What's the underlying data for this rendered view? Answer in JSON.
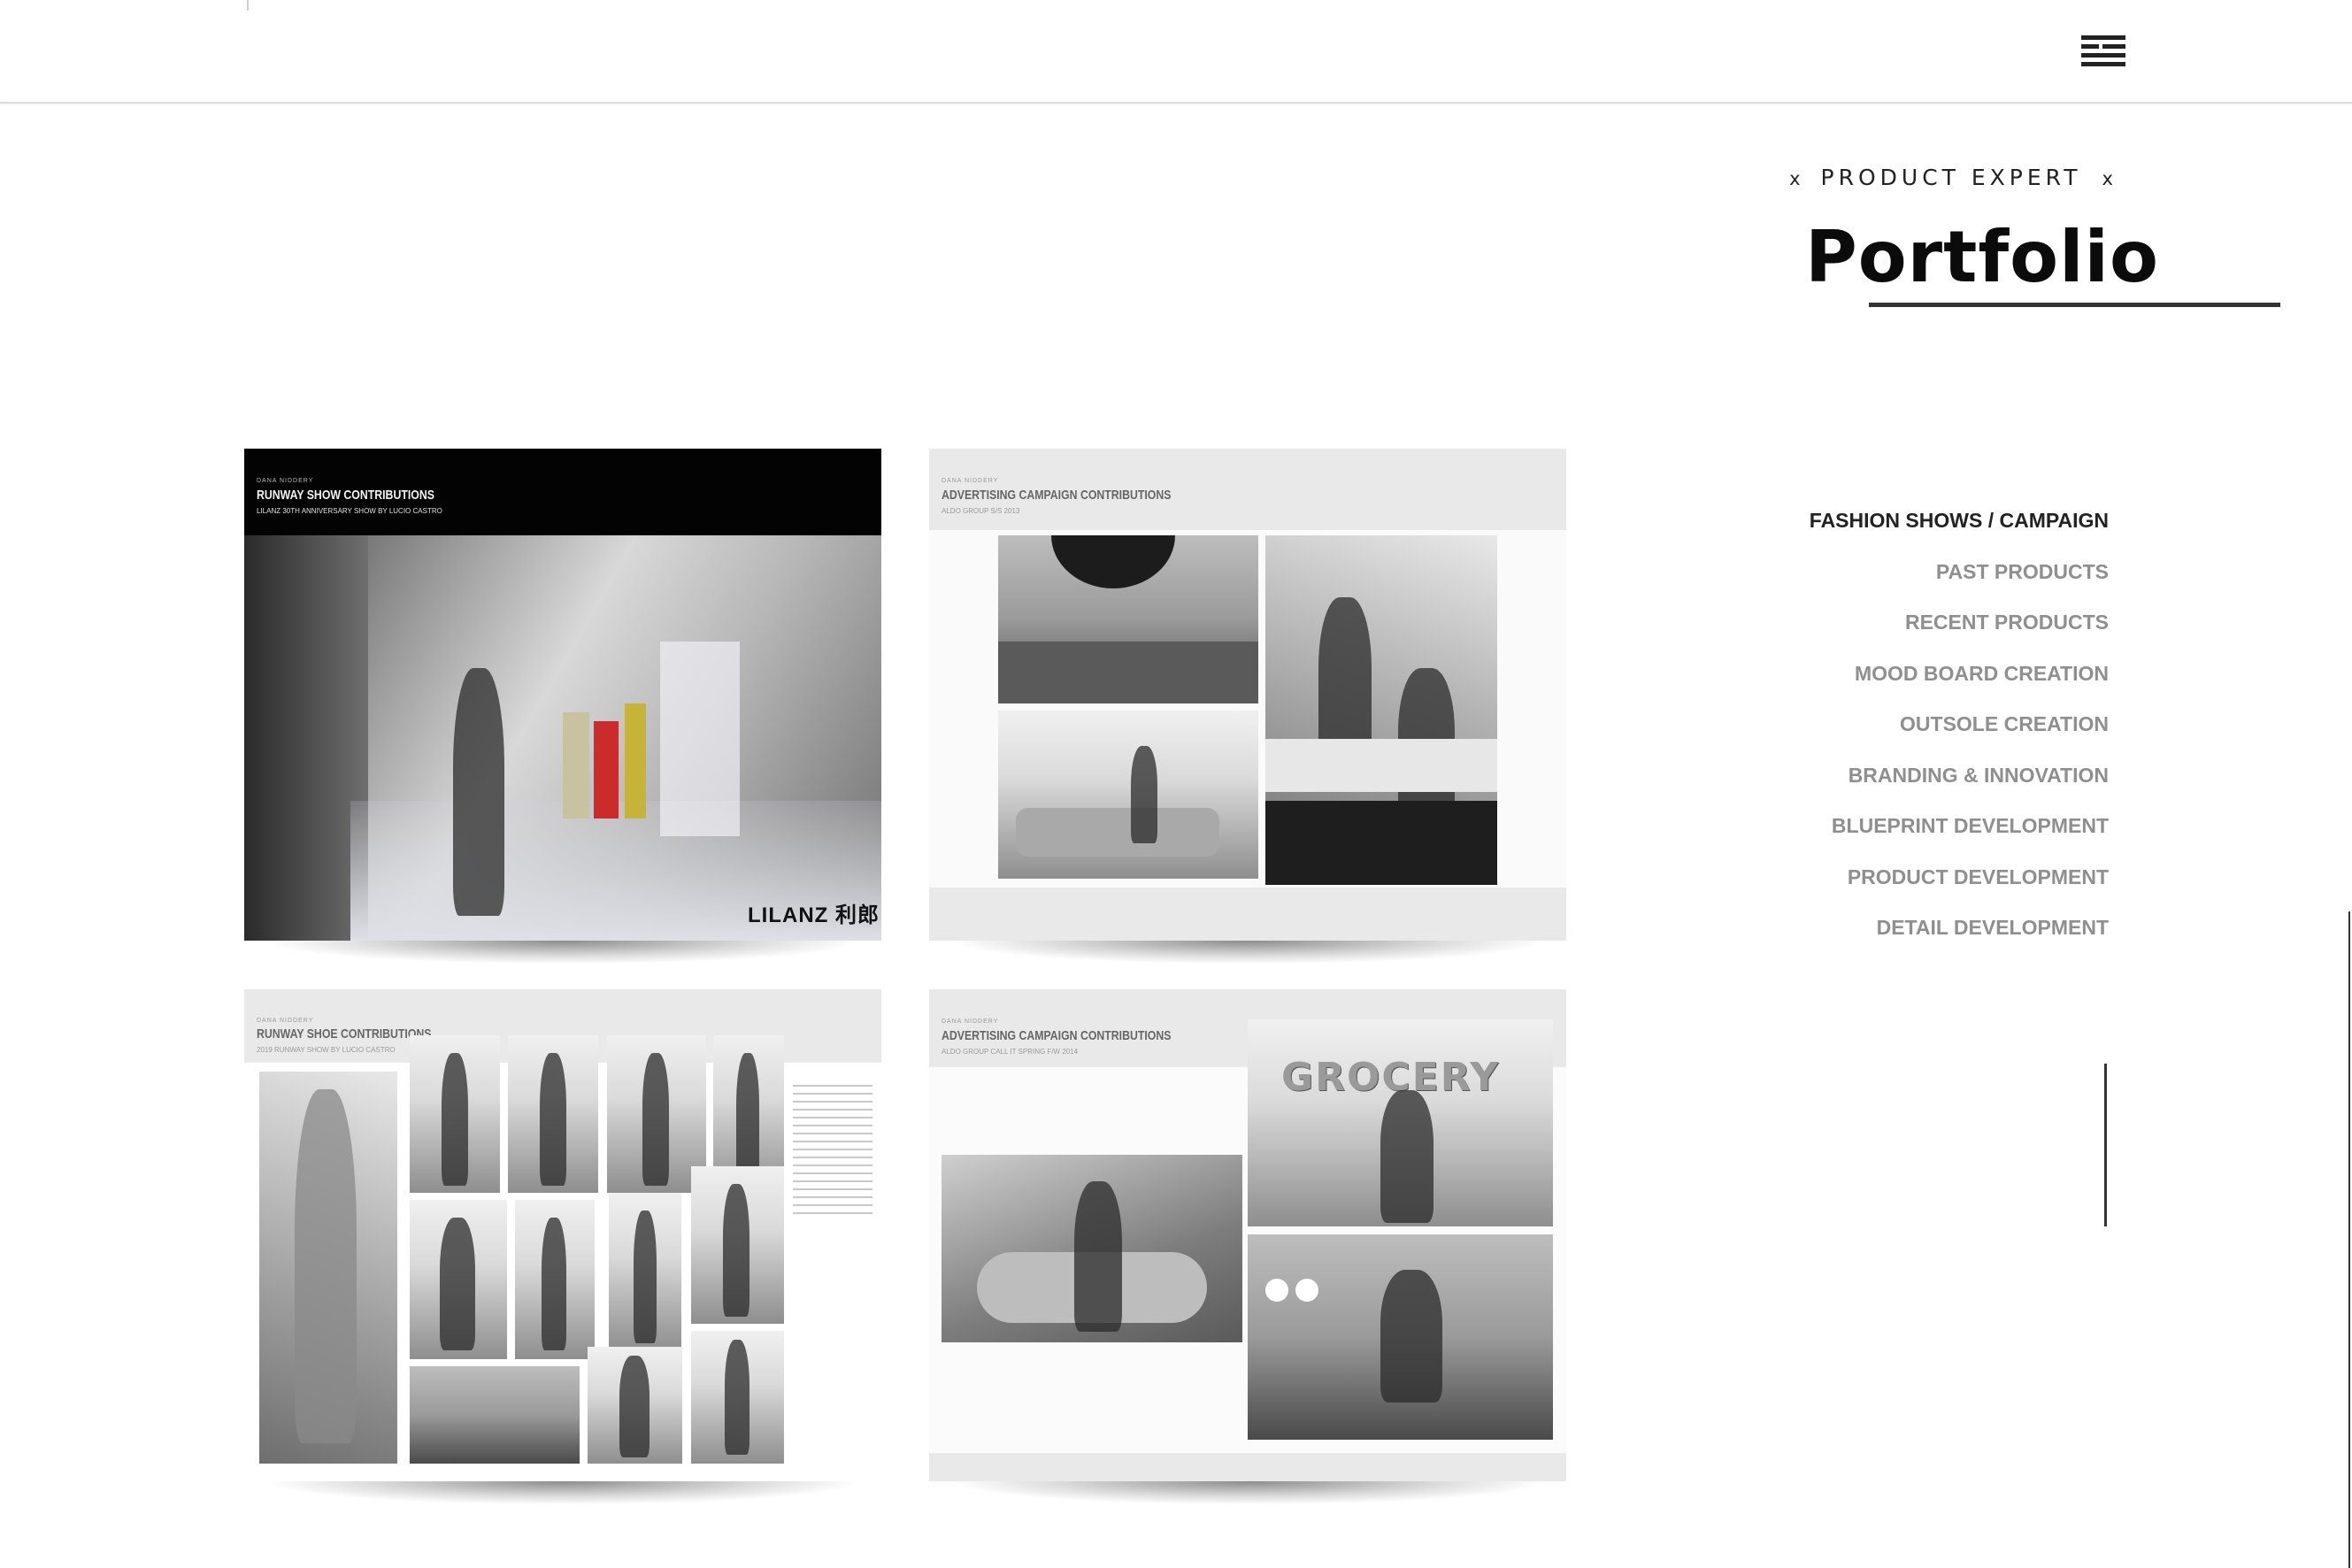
{
  "header": {
    "menu_icon": "hamburger-icon"
  },
  "hero": {
    "eyebrow_left": "x",
    "eyebrow_text": "PRODUCT EXPERT",
    "eyebrow_right": "x",
    "title": "Portfolio"
  },
  "nav": {
    "items": [
      {
        "label": "FASHION SHOWS / CAMPAIGN",
        "active": true
      },
      {
        "label": "PAST PRODUCTS",
        "active": false
      },
      {
        "label": "RECENT PRODUCTS",
        "active": false
      },
      {
        "label": "MOOD BOARD CREATION",
        "active": false
      },
      {
        "label": "OUTSOLE CREATION",
        "active": false
      },
      {
        "label": "BRANDING & INNOVATION",
        "active": false
      },
      {
        "label": "BLUEPRINT DEVELOPMENT",
        "active": false
      },
      {
        "label": "PRODUCT DEVELOPMENT",
        "active": false
      },
      {
        "label": "DETAIL DEVELOPMENT",
        "active": false
      }
    ]
  },
  "tiles": [
    {
      "author": "DANA NIDDERY",
      "title": "RUNWAY SHOW CONTRIBUTIONS",
      "subtitle": "LILANZ 30TH ANNIVERSARY SHOW BY LUCIO CASTRO",
      "brand": "LILANZ 利郎"
    },
    {
      "author": "DANA NIDDERY",
      "title": "ADVERTISING CAMPAIGN CONTRIBUTIONS",
      "subtitle": "ALDO GROUP S/S 2013"
    },
    {
      "author": "DANA NIDDERY",
      "title": "RUNWAY SHOE CONTRIBUTIONS",
      "subtitle": "2019 RUNWAY SHOW BY LUCIO CASTRO"
    },
    {
      "author": "DANA NIDDERY",
      "title": "ADVERTISING CAMPAIGN CONTRIBUTIONS",
      "subtitle": "ALDO GROUP CALL IT SPRING F/W 2014",
      "sign": "GROCERY"
    }
  ],
  "colors": {
    "accent": "#222222",
    "nav_inactive": "#8f8f8f",
    "panel": "#e9e9e9"
  }
}
